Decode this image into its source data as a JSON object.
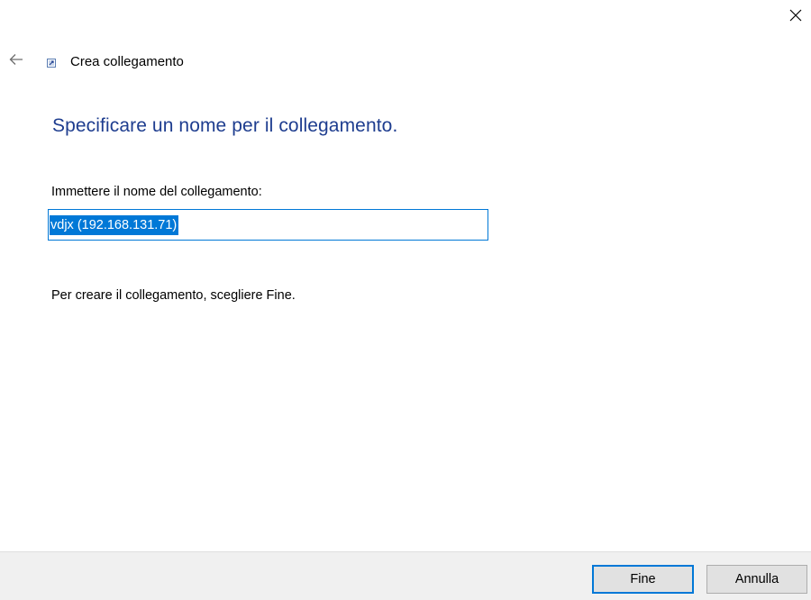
{
  "window": {
    "close_icon": "close-icon"
  },
  "header": {
    "back_icon": "back-arrow-icon",
    "app_icon": "shortcut-icon",
    "title": "Crea collegamento"
  },
  "main": {
    "heading": "Specificare un nome per il collegamento.",
    "field_label": "Immettere il nome del collegamento:",
    "name_value": "vdjx (192.168.131.71)",
    "instruction": "Per creare il collegamento, scegliere Fine."
  },
  "footer": {
    "finish_label": "Fine",
    "cancel_label": "Annulla"
  },
  "colors": {
    "heading": "#1e3d8f",
    "accent": "#0078d7",
    "footer_bg": "#f0f0f0",
    "button_bg": "#e1e1e1"
  }
}
